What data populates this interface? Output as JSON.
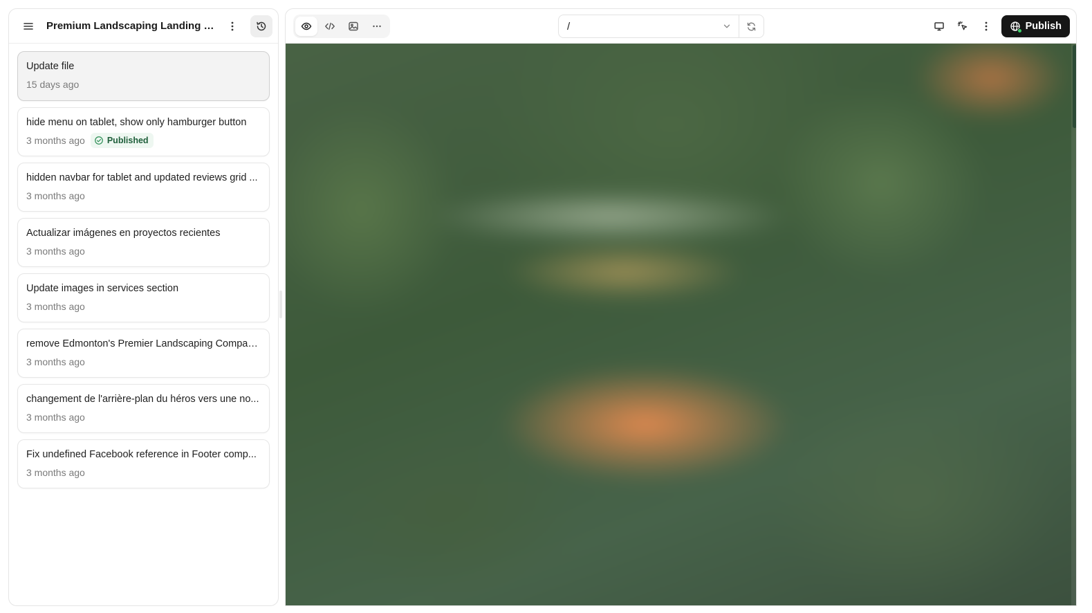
{
  "sidebar": {
    "project_title": "Premium Landscaping Landing Page ...",
    "icons": {
      "menu": "hamburger-menu-icon",
      "more": "vertical-dots-icon",
      "history": "history-icon"
    },
    "versions": [
      {
        "title": "Update file",
        "time": "15 days ago",
        "selected": true
      },
      {
        "title": "hide menu on tablet, show only hamburger button",
        "time": "3 months ago",
        "badge": "Published"
      },
      {
        "title": "hidden navbar for tablet and updated reviews grid ...",
        "time": "3 months ago"
      },
      {
        "title": "Actualizar imágenes en proyectos recientes",
        "time": "3 months ago"
      },
      {
        "title": "Update images in services section",
        "time": "3 months ago"
      },
      {
        "title": "remove Edmonton's Premier Landscaping Compan...",
        "time": "3 months ago"
      },
      {
        "title": "changement de l'arrière-plan du héros vers une no...",
        "time": "3 months ago"
      },
      {
        "title": "Fix undefined Facebook reference in Footer comp...",
        "time": "3 months ago"
      }
    ]
  },
  "toolbar": {
    "view_icons": [
      "eye-icon",
      "code-icon",
      "image-icon",
      "more-horizontal-icon"
    ],
    "url_path": "/",
    "publish_label": "Publish",
    "right_icons": [
      "desktop-icon",
      "sparkle-cursor-icon",
      "vertical-dots-icon",
      "globe-icon"
    ]
  },
  "colors": {
    "publish_bg": "#161616",
    "badge_bg": "#eef7f1",
    "badge_text": "#1e5e3a",
    "live_dot": "#3ecf6a"
  }
}
